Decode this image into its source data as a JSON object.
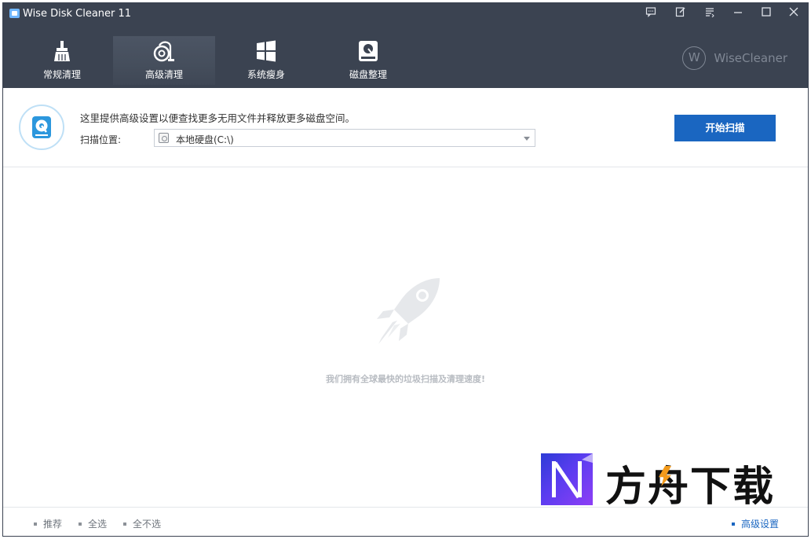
{
  "window": {
    "title": "Wise Disk Cleaner 11",
    "controls": [
      "feedback-icon",
      "edit-icon",
      "menu-icon",
      "minimize-icon",
      "maximize-icon",
      "close-icon"
    ]
  },
  "nav": {
    "items": [
      {
        "label": "常规清理",
        "icon": "broom-icon"
      },
      {
        "label": "高级清理",
        "icon": "vacuum-icon",
        "active": true
      },
      {
        "label": "系统瘦身",
        "icon": "windows-icon"
      },
      {
        "label": "磁盘整理",
        "icon": "disk-defrag-icon"
      }
    ]
  },
  "brand": {
    "mark": "W",
    "name": "WiseCleaner"
  },
  "info": {
    "intro": "这里提供高级设置以便查找更多无用文件并释放更多磁盘空间。",
    "scan_location_label": "扫描位置:",
    "scan_location_value": "本地硬盘(C:\\)",
    "start_button": "开始扫描"
  },
  "main": {
    "tagline": "我们拥有全球最快的垃圾扫描及清理速度!"
  },
  "footer": {
    "recommend": "推荐",
    "select_all": "全选",
    "select_none": "全不选",
    "advanced_settings": "高级设置"
  },
  "watermark": {
    "text": "方舟下载"
  },
  "colors": {
    "header_bg": "#3b4351",
    "accent": "#1a66c1",
    "watermark_gradient_start": "#2d3cd6",
    "watermark_gradient_end": "#8d3ef5",
    "bolt": "#f29a1c"
  }
}
